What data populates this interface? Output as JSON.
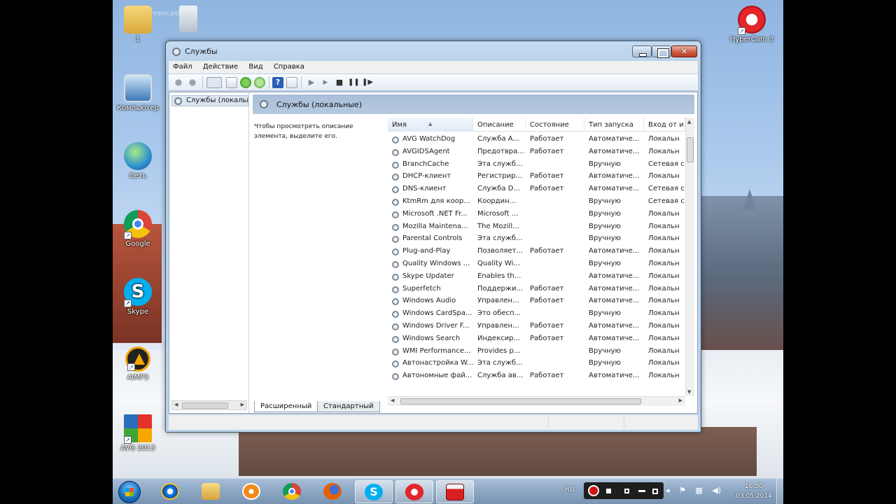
{
  "desktop": {
    "watermark": "www.screencast.tv",
    "icons": [
      {
        "label": "1",
        "icon": "folder-icon"
      },
      {
        "label": "Компьютер",
        "icon": "computer-icon"
      },
      {
        "label": "Сеть",
        "icon": "network-icon"
      },
      {
        "label": "Google",
        "icon": "chrome-icon"
      },
      {
        "label": "Skype",
        "icon": "skype-icon"
      },
      {
        "label": "AIMP3",
        "icon": "aimp-icon"
      },
      {
        "label": "AVG 2013",
        "icon": "avg-icon"
      },
      {
        "label": "HyperCam 3",
        "icon": "hypercam-icon"
      }
    ]
  },
  "window": {
    "title": "Службы",
    "menu": [
      "Файл",
      "Действие",
      "Вид",
      "Справка"
    ],
    "tree_item": "Службы (локальные)",
    "header": "Службы (локальные)",
    "description": "Чтобы просмотреть описание элемента, выделите его.",
    "columns": [
      "Имя",
      "Описание",
      "Состояние",
      "Тип запуска",
      "Вход от и"
    ],
    "services": [
      [
        "AVG WatchDog",
        "Служба A...",
        "Работает",
        "Автоматиче...",
        "Локальн"
      ],
      [
        "AVGIDSAgent",
        "Предотвра...",
        "Работает",
        "Автоматиче...",
        "Локальн"
      ],
      [
        "BranchCache",
        "Эта служб...",
        "",
        "Вручную",
        "Сетевая с"
      ],
      [
        "DHCP-клиент",
        "Регистрир...",
        "Работает",
        "Автоматиче...",
        "Локальн"
      ],
      [
        "DNS-клиент",
        "Служба D...",
        "Работает",
        "Автоматиче...",
        "Сетевая с"
      ],
      [
        "KtmRm для коор...",
        "Координ...",
        "",
        "Вручную",
        "Сетевая с"
      ],
      [
        "Microsoft .NET Fr...",
        "Microsoft ...",
        "",
        "Вручную",
        "Локальн"
      ],
      [
        "Mozilla Maintena...",
        "The Mozill...",
        "",
        "Вручную",
        "Локальн"
      ],
      [
        "Parental Controls",
        "Эта служб...",
        "",
        "Вручную",
        "Локальн"
      ],
      [
        "Plug-and-Play",
        "Позволяет...",
        "Работает",
        "Автоматиче...",
        "Локальн"
      ],
      [
        "Quality Windows ...",
        "Quality Wi...",
        "",
        "Вручную",
        "Локальн"
      ],
      [
        "Skype Updater",
        "Enables th...",
        "",
        "Автоматиче...",
        "Локальн"
      ],
      [
        "Superfetch",
        "Поддержи...",
        "Работает",
        "Автоматиче...",
        "Локальн"
      ],
      [
        "Windows Audio",
        "Управлен...",
        "Работает",
        "Автоматиче...",
        "Локальн"
      ],
      [
        "Windows CardSpa...",
        "Это обесп...",
        "",
        "Вручную",
        "Локальн"
      ],
      [
        "Windows Driver F...",
        "Управлен...",
        "Работает",
        "Автоматиче...",
        "Локальн"
      ],
      [
        "Windows Search",
        "Индексир...",
        "Работает",
        "Автоматиче...",
        "Локальн"
      ],
      [
        "WMI Performance...",
        "Provides p...",
        "",
        "Вручную",
        "Локальн"
      ],
      [
        "Автонастройка W...",
        "Эта служб...",
        "",
        "Вручную",
        "Локальн"
      ],
      [
        "Автономные фай...",
        "Служба ав...",
        "Работает",
        "Автоматиче...",
        "Локальн"
      ]
    ],
    "tabs": [
      "Расширенный",
      "Стандартный"
    ]
  },
  "taskbar": {
    "apps": [
      "ie-icon",
      "explorer-icon",
      "media-player-icon",
      "chrome-icon",
      "firefox-icon",
      "skype-icon",
      "hypercam-icon",
      "services-icon"
    ],
    "lang": "RU",
    "time": "16:50",
    "date": "03.05.2014"
  },
  "colors": {
    "taskbar": "#8ea8c5",
    "window_frame": "#bcd3ec",
    "close_button": "#d3644c"
  }
}
